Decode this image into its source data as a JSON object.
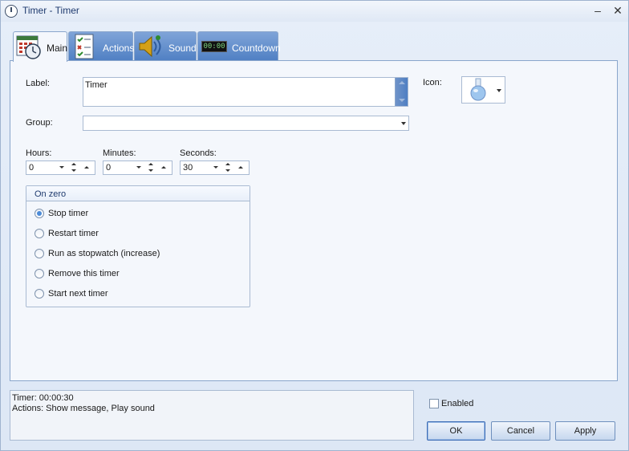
{
  "window": {
    "title": "Timer - Timer",
    "minimize": "–",
    "close": "✕"
  },
  "tabs": [
    {
      "label": "Main",
      "icon": "calendar-clock-icon",
      "active": true
    },
    {
      "label": "Actions",
      "icon": "checklist-icon",
      "active": false
    },
    {
      "label": "Sound",
      "icon": "speaker-icon",
      "active": false
    },
    {
      "label": "Countdown",
      "icon": "digital-display-icon",
      "active": false,
      "display": "00:00"
    }
  ],
  "main": {
    "label_caption": "Label:",
    "label_value": "Timer",
    "group_caption": "Group:",
    "group_value": "",
    "icon_caption": "Icon:",
    "icon_value": "flask-icon",
    "hours_caption": "Hours:",
    "hours_value": "0",
    "minutes_caption": "Minutes:",
    "minutes_value": "0",
    "seconds_caption": "Seconds:",
    "seconds_value": "30",
    "on_zero": {
      "title": "On zero",
      "options": [
        {
          "label": "Stop timer",
          "checked": true
        },
        {
          "label": "Restart timer",
          "checked": false
        },
        {
          "label": "Run as stopwatch (increase)",
          "checked": false
        },
        {
          "label": "Remove this timer",
          "checked": false
        },
        {
          "label": "Start next timer",
          "checked": false
        }
      ]
    }
  },
  "summary": {
    "line1": "Timer: 00:00:30",
    "line2": "Actions: Show message, Play sound"
  },
  "footer": {
    "enabled_label": "Enabled",
    "enabled_checked": false,
    "ok_label": "OK",
    "cancel_label": "Cancel",
    "apply_label": "Apply"
  },
  "colors": {
    "accent": "#4f7fc3",
    "title_text": "#1e3a6e",
    "panel_bg": "#f4f7fc",
    "window_bg": "#dde7f5"
  }
}
